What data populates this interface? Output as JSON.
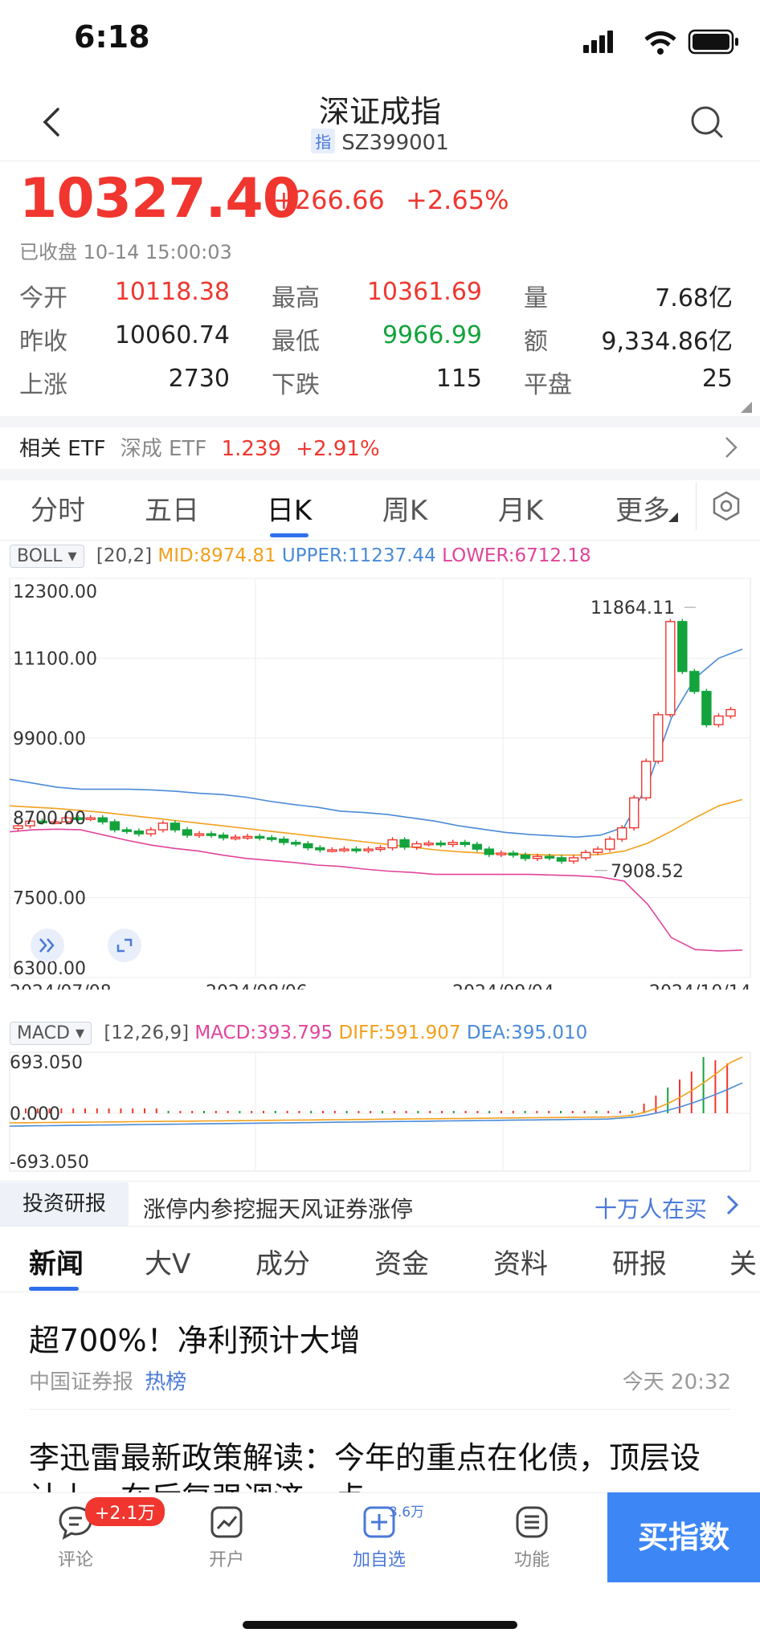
{
  "status_bar": {
    "time": "6:18"
  },
  "header": {
    "title": "深证成指",
    "code_badge": "指",
    "code": "SZ399001"
  },
  "quote": {
    "price": "10327.40",
    "change_abs": "+266.66",
    "change_pct": "+2.65%",
    "status": "已收盘 10-14 15:00:03"
  },
  "stats": [
    [
      {
        "label": "今开",
        "value": "10118.38",
        "tone": "red"
      },
      {
        "label": "最高",
        "value": "10361.69",
        "tone": "red"
      },
      {
        "label": "量",
        "value": "7.68亿",
        "tone": "dark"
      }
    ],
    [
      {
        "label": "昨收",
        "value": "10060.74",
        "tone": "dark"
      },
      {
        "label": "最低",
        "value": "9966.99",
        "tone": "green"
      },
      {
        "label": "额",
        "value": "9,334.86亿",
        "tone": "dark"
      }
    ],
    [
      {
        "label": "上涨",
        "value": "2730",
        "tone": "dark"
      },
      {
        "label": "下跌",
        "value": "115",
        "tone": "dark"
      },
      {
        "label": "平盘",
        "value": "25",
        "tone": "dark"
      }
    ]
  ],
  "etf": {
    "label": "相关 ETF",
    "name": "深成 ETF",
    "price": "1.239",
    "change": "+2.91%"
  },
  "chart_tabs": [
    "分时",
    "五日",
    "日K",
    "周K",
    "月K",
    "更多"
  ],
  "boll": {
    "name": "BOLL",
    "params": "[20,2]",
    "mid": "MID:8974.81",
    "upper": "UPPER:11237.44",
    "lower": "LOWER:6712.18"
  },
  "macd_header": {
    "name": "MACD",
    "params": "[12,26,9]",
    "macd": "MACD:393.795",
    "diff": "DIFF:591.907",
    "dea": "DEA:395.010"
  },
  "chart_data": [
    {
      "type": "candlestick",
      "y_ticks": [
        "12300.00",
        "11100.00",
        "9900.00",
        "8700.00",
        "7500.00",
        "6300.00"
      ],
      "ylim": [
        6300,
        12300
      ],
      "x_ticks": [
        "2024/07/08",
        "2024/08/06",
        "2024/09/04",
        "2024/10/14"
      ],
      "annotations": {
        "high": "11864.11",
        "low": "7908.52"
      },
      "series": [
        {
          "name": "MID",
          "values": [
            8880,
            8860,
            8840,
            8810,
            8780,
            8740,
            8700,
            8660,
            8620,
            8580,
            8540,
            8500,
            8460,
            8420,
            8380,
            8340,
            8300,
            8260,
            8220,
            8190,
            8170,
            8160,
            8150,
            8140,
            8140,
            8150,
            8200,
            8320,
            8500,
            8700,
            8880,
            8975
          ]
        },
        {
          "name": "UPPER",
          "values": [
            9280,
            9220,
            9160,
            9130,
            9130,
            9130,
            9120,
            9100,
            9070,
            9050,
            9010,
            8950,
            8900,
            8860,
            8800,
            8780,
            8750,
            8700,
            8650,
            8580,
            8530,
            8480,
            8450,
            8430,
            8410,
            8440,
            8560,
            9200,
            10200,
            10800,
            11100,
            11237
          ]
        },
        {
          "name": "LOWER",
          "values": [
            8490,
            8520,
            8530,
            8520,
            8440,
            8360,
            8290,
            8240,
            8200,
            8140,
            8090,
            8060,
            8030,
            7990,
            7970,
            7930,
            7900,
            7880,
            7850,
            7850,
            7850,
            7850,
            7850,
            7840,
            7830,
            7810,
            7750,
            7400,
            6900,
            6720,
            6700,
            6712
          ]
        }
      ],
      "candles": [
        8580,
        8650,
        8640,
        8640,
        8700,
        8690,
        8700,
        8640,
        8520,
        8500,
        8460,
        8520,
        8620,
        8520,
        8440,
        8460,
        8440,
        8400,
        8410,
        8420,
        8400,
        8380,
        8330,
        8310,
        8250,
        8220,
        8220,
        8230,
        8210,
        8230,
        8250,
        8370,
        8260,
        8310,
        8320,
        8300,
        8330,
        8300,
        8230,
        8150,
        8170,
        8140,
        8090,
        8120,
        8100,
        8050,
        8100,
        8180,
        8230,
        8380,
        8550,
        9000,
        9550,
        10250,
        11650,
        10900,
        10600,
        10100,
        10230,
        10327
      ]
    },
    {
      "type": "bar+line",
      "y_ticks": [
        "693.050",
        "0.000",
        "-693.050"
      ],
      "ylim": [
        -693.05,
        693.05
      ]
    }
  ],
  "research": {
    "tag": "投资研报",
    "text": "涨停内参挖掘天风证券涨停",
    "link": "十万人在买"
  },
  "news_tabs": [
    "新闻",
    "大V",
    "成分",
    "资金",
    "资料",
    "研报",
    "关"
  ],
  "news": [
    {
      "title": "超700%！净利预计大增",
      "source": "中国证券报",
      "tag": "热榜",
      "time": "今天 20:32"
    },
    {
      "title": "李迅雷最新政策解读：今年的重点在化债，顶层设",
      "title2": "计上，在后复强调济，点"
    }
  ],
  "bottom_nav": {
    "comment": "评论",
    "comment_badge": "+2.1万",
    "open": "开户",
    "watch": "加自选",
    "watch_badge": "3.6万",
    "tools": "功能",
    "buy": "买指数"
  },
  "colors": {
    "up": "#f0362f",
    "down": "#13a33c",
    "accent": "#3d86f6"
  }
}
